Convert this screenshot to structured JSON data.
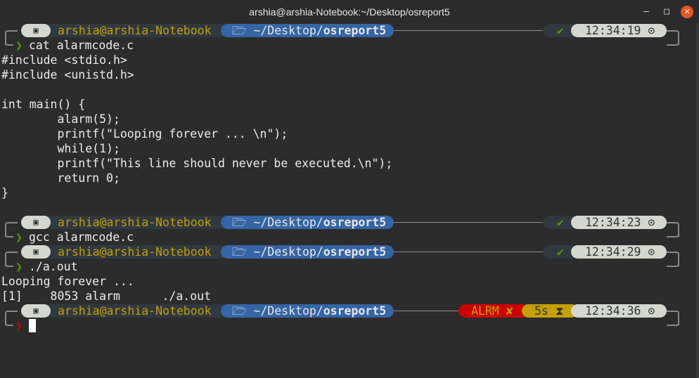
{
  "window": {
    "title": "arshia@arshia-Notebook:~/Desktop/osreport5"
  },
  "prompt": {
    "os_icon": "linux-mint-icon",
    "context": "arshia@arshia-Notebook",
    "dir_prefix": "~/Desktop/",
    "dir_name": "osreport5",
    "folder_icon": "🗁",
    "ok_icon": "✔",
    "clock_icon": "⊙",
    "chevron": "❯"
  },
  "blocks": [
    {
      "time": "12:34:19",
      "command": "cat alarmcode.c",
      "status": "ok"
    },
    {
      "time": "12:34:23",
      "command": "gcc alarmcode.c",
      "status": "ok"
    },
    {
      "time": "12:34:29",
      "command": "./a.out",
      "status": "ok"
    },
    {
      "time": "12:34:36",
      "command": "",
      "status": "error",
      "alarm_label": "ALRM",
      "alarm_icon": "✘",
      "duration": "5s",
      "hourglass_icon": "⧗"
    }
  ],
  "output": {
    "cat": [
      "#include <stdio.h>",
      "#include <unistd.h>",
      "",
      "int main() {",
      "        alarm(5);",
      "        printf(\"Looping forever ... \\n\");",
      "        while(1);",
      "        printf(\"This line should never be executed.\\n\");",
      "        return 0;",
      "}",
      ""
    ],
    "aout": [
      "Looping forever ...",
      "[1]    8053 alarm      ./a.out"
    ]
  }
}
